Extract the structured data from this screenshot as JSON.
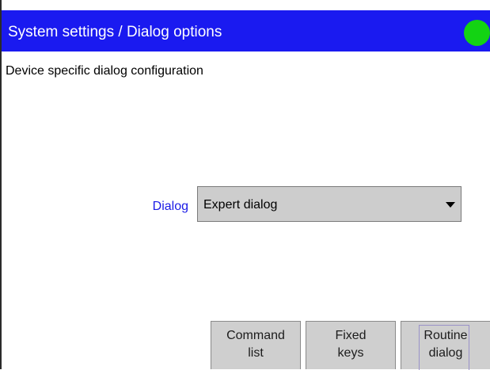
{
  "title_bar": {
    "title": "System settings / Dialog options",
    "background_color": "#1a1af0",
    "status_indicator": {
      "icon": "status-led-icon",
      "color": "#13d313"
    }
  },
  "main": {
    "subtitle": "Device specific dialog configuration",
    "dialog_field": {
      "label": "Dialog",
      "label_color": "#1a1ae6",
      "selected_value": "Expert dialog",
      "dropdown_icon": "caret-down-icon"
    }
  },
  "softkeys": [
    {
      "label": "Command\nlist"
    },
    {
      "label": "Fixed\nkeys"
    },
    {
      "label": "Routine\ndialog",
      "focused": true
    }
  ]
}
